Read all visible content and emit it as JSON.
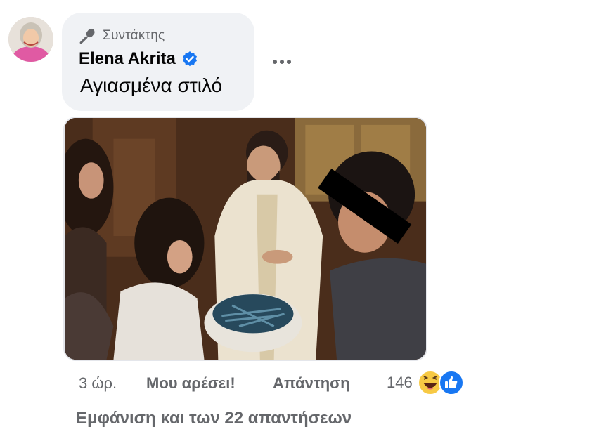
{
  "comment": {
    "badge_label": "Συντάκτης",
    "author_name": "Elena Akrita",
    "text": "Αγιασμένα στιλό",
    "badge_icon": "microphone-icon",
    "verified_icon": "verified-badge-icon",
    "accent_color": "#1877f2"
  },
  "actions": {
    "time": "3 ώρ.",
    "like_label": "Μου αρέσει!",
    "reply_label": "Απάντηση",
    "reaction_count": "146",
    "reaction_icons": [
      "haha-reaction-icon",
      "like-reaction-icon"
    ]
  },
  "view_replies_label": "Εμφάνιση και των 22 απαντήσεων"
}
